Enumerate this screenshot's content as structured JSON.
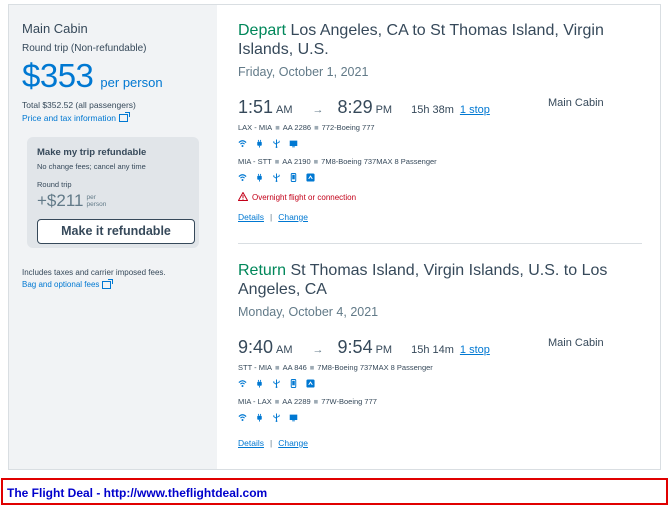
{
  "sidebar": {
    "cabin": "Main Cabin",
    "trip_type": "Round trip (Non-refundable)",
    "price": "$353",
    "per_person": "per person",
    "total": "Total $352.52 (all passengers)",
    "price_tax_link": "Price and tax information",
    "refundable": {
      "title": "Make my trip refundable",
      "subtitle": "No change fees; cancel any time",
      "round_trip": "Round trip",
      "price": "+$211",
      "per_line1": "per",
      "per_line2": "person",
      "button": "Make it refundable"
    },
    "includes": "Includes taxes and carrier imposed fees.",
    "bag_link": "Bag and optional fees"
  },
  "depart": {
    "direction": "Depart",
    "route": "Los Angeles, CA to St Thomas Island, Virgin Islands, U.S.",
    "date": "Friday, October 1, 2021",
    "dep_time": "1:51",
    "dep_ampm": "AM",
    "arr_time": "8:29",
    "arr_ampm": "PM",
    "duration": "15h 38m",
    "stops": "1 stop",
    "cabin": "Main Cabin",
    "legs": [
      {
        "route": "LAX - MIA",
        "flight": "AA 2286",
        "aircraft": "772-Boeing 777"
      },
      {
        "route": "MIA - STT",
        "flight": "AA 2190",
        "aircraft": "7M8-Boeing 737MAX 8 Passenger"
      }
    ],
    "warning": "Overnight flight or connection",
    "details": "Details",
    "change": "Change"
  },
  "return": {
    "direction": "Return",
    "route": "St Thomas Island, Virgin Islands, U.S. to Los Angeles, CA",
    "date": "Monday, October 4, 2021",
    "dep_time": "9:40",
    "dep_ampm": "AM",
    "arr_time": "9:54",
    "arr_ampm": "PM",
    "duration": "15h 14m",
    "stops": "1 stop",
    "cabin": "Main Cabin",
    "legs": [
      {
        "route": "STT - MIA",
        "flight": "AA 846",
        "aircraft": "7M8-Boeing 737MAX 8 Passenger"
      },
      {
        "route": "MIA - LAX",
        "flight": "AA 2289",
        "aircraft": "77W-Boeing 777"
      }
    ],
    "details": "Details",
    "change": "Change"
  },
  "banner": {
    "text": "The Flight Deal - http://www.theflightdeal.com"
  },
  "colors": {
    "accent": "#0078d2",
    "green": "#00875a",
    "warning": "#c30019",
    "banner_border": "#e00000",
    "banner_text": "#0000cc"
  }
}
